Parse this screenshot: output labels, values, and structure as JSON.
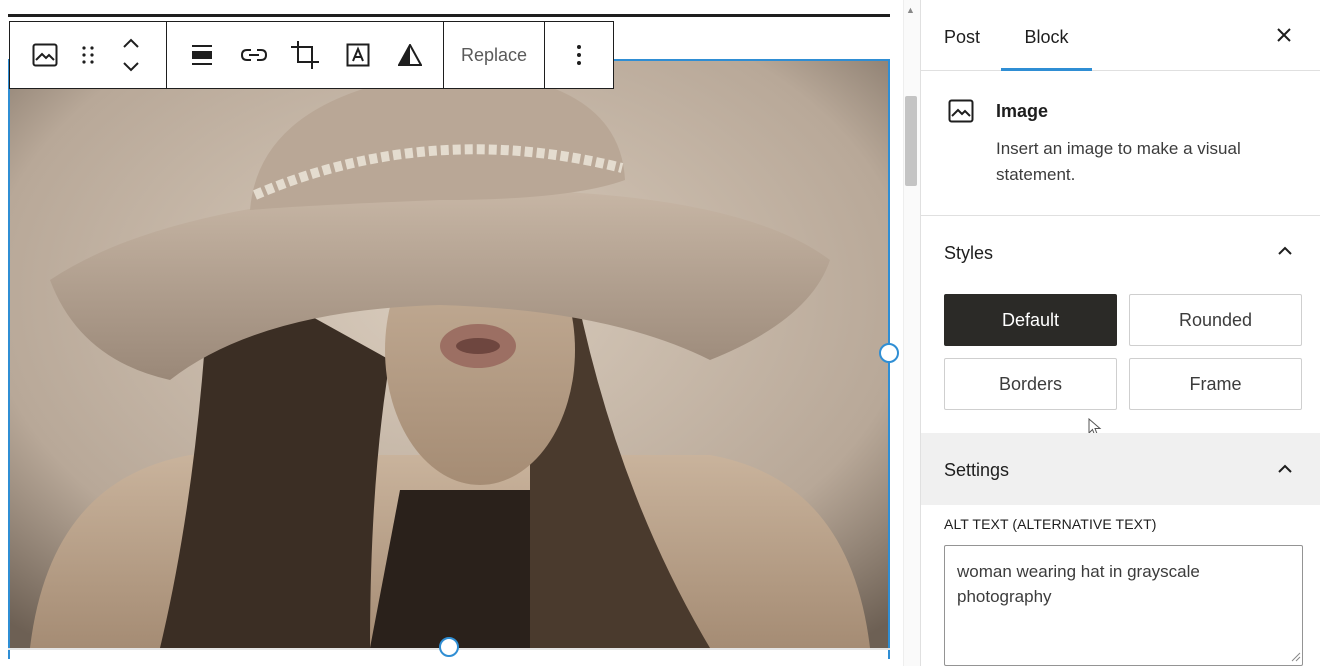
{
  "toolbar": {
    "items": [
      {
        "name": "block-type",
        "icon": "image-icon"
      },
      {
        "name": "drag-handle",
        "icon": "drag-dots-icon"
      },
      {
        "name": "move",
        "icon": "move-up-down-icon"
      },
      {
        "name": "align",
        "icon": "align-icon"
      },
      {
        "name": "link",
        "icon": "link-icon"
      },
      {
        "name": "crop",
        "icon": "crop-icon"
      },
      {
        "name": "text-overlay",
        "icon": "text-overlay-icon"
      },
      {
        "name": "duotone",
        "icon": "duotone-filter-icon"
      },
      {
        "name": "more-options",
        "icon": "kebab-icon"
      }
    ],
    "replace_label": "Replace"
  },
  "canvas": {
    "accent_color": "#2f8ed4",
    "photo_description_icon": "photo-of-woman-in-hat"
  },
  "sidebar": {
    "tabs": [
      {
        "label": "Post",
        "active": false
      },
      {
        "label": "Block",
        "active": true
      }
    ],
    "close_icon": "close-icon",
    "block": {
      "icon": "image-icon",
      "title": "Image",
      "description": "Insert an image to make a visual statement."
    },
    "styles": {
      "title": "Styles",
      "expanded": true,
      "options": [
        "Default",
        "Rounded",
        "Borders",
        "Frame"
      ],
      "selected": "Default"
    },
    "settings": {
      "title": "Settings",
      "expanded": true,
      "alt_label": "ALT TEXT (ALTERNATIVE TEXT)",
      "alt_value": "woman wearing hat in grayscale photography"
    },
    "colors": {
      "accent": "#2f8ed4",
      "selected_style_bg": "#2b2a27",
      "settings_header_bg": "#f0f0f0"
    }
  }
}
